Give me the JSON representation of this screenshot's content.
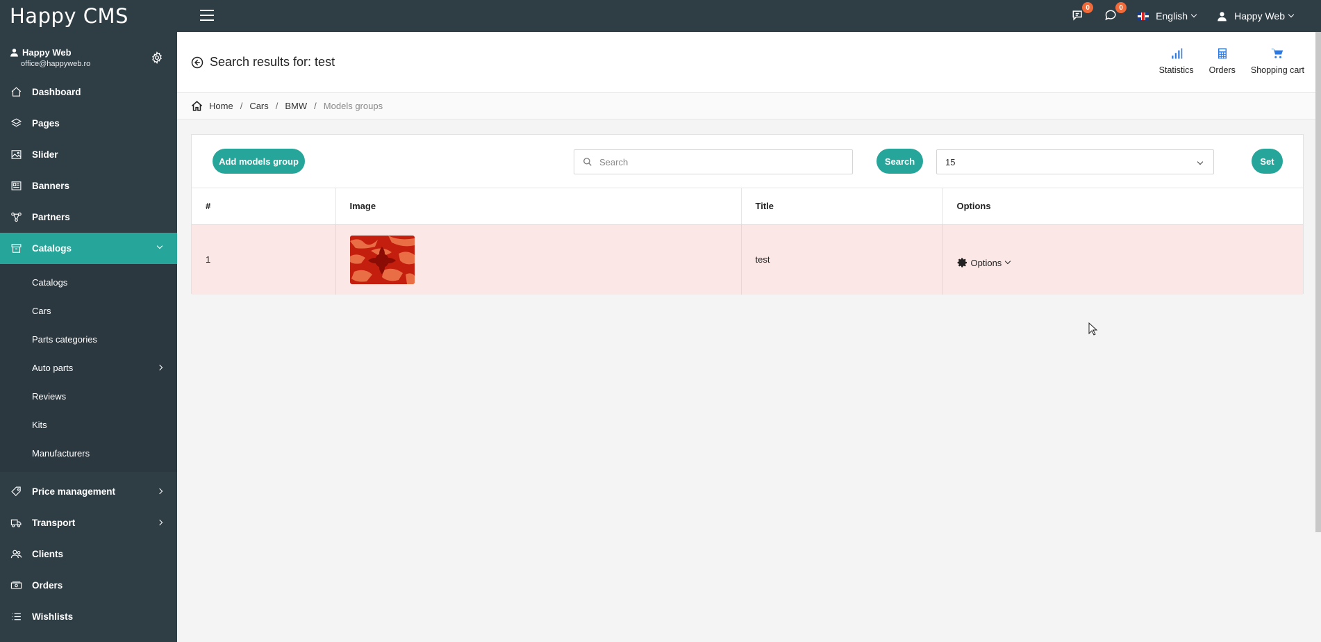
{
  "app": {
    "logo_text": "Happy CMS"
  },
  "topbar": {
    "notifications": [
      {
        "icon": "chat-list-icon",
        "count": "0"
      },
      {
        "icon": "speech-bubbles-icon",
        "count": "0"
      }
    ],
    "language": "English",
    "user": "Happy Web"
  },
  "sidebar": {
    "profile": {
      "name": "Happy Web",
      "email": "office@happyweb.ro"
    },
    "items_top": [
      {
        "label": "Dashboard",
        "icon": "home-icon"
      },
      {
        "label": "Pages",
        "icon": "layers-icon"
      },
      {
        "label": "Slider",
        "icon": "image-icon"
      },
      {
        "label": "Banners",
        "icon": "newspaper-icon"
      },
      {
        "label": "Partners",
        "icon": "network-icon"
      }
    ],
    "catalogs": {
      "label": "Catalogs",
      "icon": "archive-icon"
    },
    "submenu": [
      "Catalogs",
      "Cars",
      "Parts categories",
      "Auto parts",
      "Reviews",
      "Kits",
      "Manufacturers"
    ],
    "items_bottom": [
      {
        "label": "Price management",
        "icon": "price-tag-icon",
        "has_children": true
      },
      {
        "label": "Transport",
        "icon": "truck-icon",
        "has_children": true
      },
      {
        "label": "Clients",
        "icon": "users-icon",
        "has_children": false
      },
      {
        "label": "Orders",
        "icon": "cash-icon",
        "has_children": false
      },
      {
        "label": "Wishlists",
        "icon": "list-icon",
        "has_children": false
      }
    ]
  },
  "header": {
    "title": "Search results for: test",
    "actions": [
      {
        "label": "Statistics",
        "icon": "bar-chart-icon"
      },
      {
        "label": "Orders",
        "icon": "calculator-icon"
      },
      {
        "label": "Shopping cart",
        "icon": "cart-icon"
      }
    ]
  },
  "breadcrumb": {
    "items": [
      "Home",
      "Cars",
      "BMW"
    ],
    "current": "Models groups"
  },
  "toolbar": {
    "add_label": "Add models group",
    "search_placeholder": "Search",
    "search_button": "Search",
    "per_page": "15",
    "set_button": "Set"
  },
  "table": {
    "columns": [
      "#",
      "Image",
      "Title",
      "Options"
    ],
    "rows": [
      {
        "num": "1",
        "title": "test",
        "options_label": "Options"
      }
    ]
  },
  "colors": {
    "sidebar_bg": "#2f3d45",
    "accent": "#26a69a",
    "row_highlight": "#fbe7e5",
    "badge": "#f06a3a"
  }
}
